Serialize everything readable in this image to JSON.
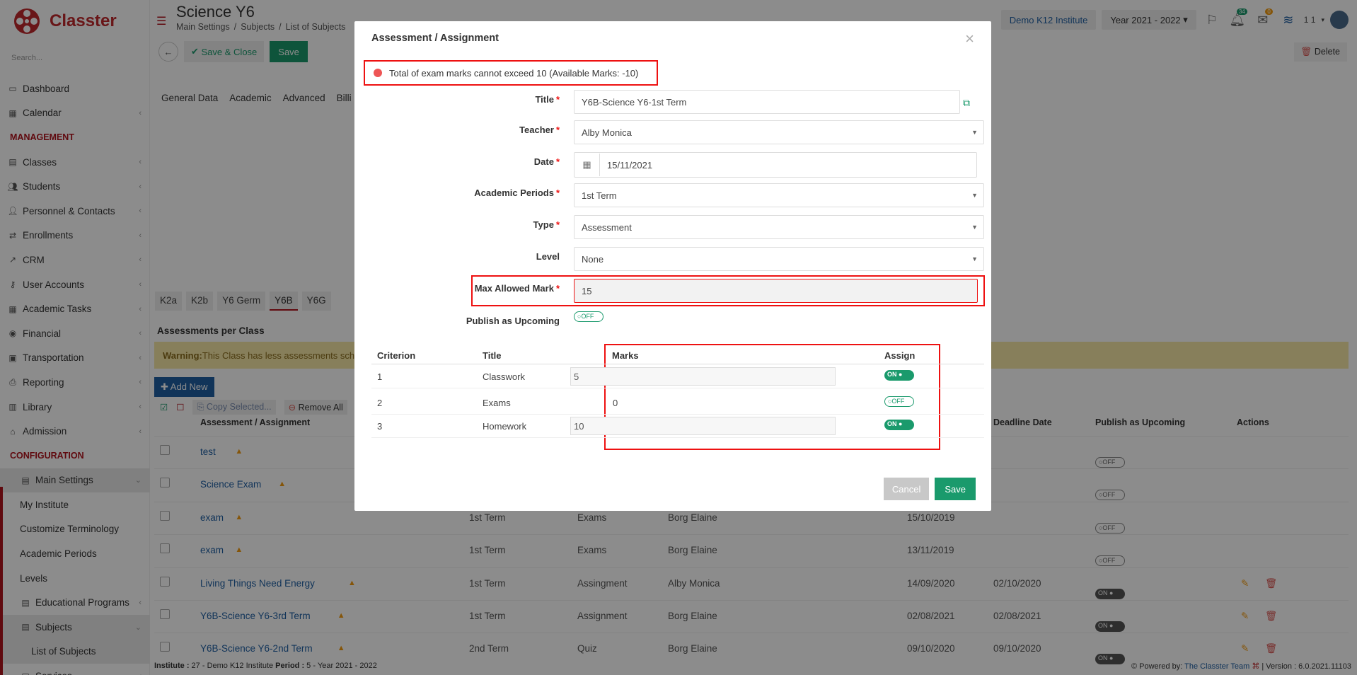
{
  "app": {
    "name": "Classter"
  },
  "sidebar": {
    "search_placeholder": "Search...",
    "items": [
      {
        "label": "Dashboard",
        "icon": "monitor-icon",
        "chev": ""
      },
      {
        "label": "Calendar",
        "icon": "calendar-icon",
        "chev": "‹"
      }
    ],
    "management_label": "MANAGEMENT",
    "mgmt_items": [
      {
        "label": "Classes",
        "icon": "classes-icon",
        "chev": "‹"
      },
      {
        "label": "Students",
        "icon": "students-icon",
        "chev": "‹"
      },
      {
        "label": "Personnel & Contacts",
        "icon": "personnel-icon",
        "chev": "‹"
      },
      {
        "label": "Enrollments",
        "icon": "enrollments-icon",
        "chev": "‹"
      },
      {
        "label": "CRM",
        "icon": "crm-icon",
        "chev": "‹"
      },
      {
        "label": "User Accounts",
        "icon": "key-icon",
        "chev": "‹"
      },
      {
        "label": "Academic Tasks",
        "icon": "tasks-icon",
        "chev": "‹"
      },
      {
        "label": "Financial",
        "icon": "financial-icon",
        "chev": "‹"
      },
      {
        "label": "Transportation",
        "icon": "bus-icon",
        "chev": "‹"
      },
      {
        "label": "Reporting",
        "icon": "printer-icon",
        "chev": "‹"
      },
      {
        "label": "Library",
        "icon": "library-icon",
        "chev": "‹"
      },
      {
        "label": "Admission",
        "icon": "admission-icon",
        "chev": "‹"
      }
    ],
    "configuration_label": "CONFIGURATION",
    "main_settings": "Main Settings",
    "settings_items": [
      "My Institute",
      "Customize Terminology",
      "Academic Periods",
      "Levels"
    ],
    "educational_programs": "Educational Programs",
    "subjects": "Subjects",
    "list_of_subjects": "List of Subjects",
    "services": "Services"
  },
  "header": {
    "title": "Science Y6",
    "breadcrumb": [
      "Main Settings",
      "/",
      "Subjects",
      "/",
      "List of Subjects"
    ],
    "institute": "Demo K12 Institute",
    "year": "Year 2021 - 2022",
    "notif_count": "34",
    "msg_count": "0",
    "user": "1 1"
  },
  "toolbar": {
    "save_close": "Save & Close",
    "save": "Save",
    "delete": "Delete"
  },
  "tabs": [
    "General Data",
    "Academic",
    "Advanced",
    "Billi"
  ],
  "class_tabs": [
    "K2a",
    "K2b",
    "Y6 Germ",
    "Y6B",
    "Y6G"
  ],
  "assessments": {
    "title": "Assessments per Class",
    "warning_bold": "Warning:",
    "warning_text": " This Class has less assessments sche",
    "add_new": "Add New",
    "copy_selected": "Copy Selected...",
    "remove_all": "Remove All",
    "columns": {
      "name": "Assessment / Assignment",
      "deadline": "Deadline Date",
      "publish": "Publish as Upcoming",
      "actions": "Actions"
    },
    "rows": [
      {
        "name": "test",
        "period": "",
        "type": "",
        "teacher": "",
        "date": "",
        "deadline": "",
        "publish": "OFF",
        "actions": false,
        "warn": true
      },
      {
        "name": "Science Exam",
        "period": "",
        "type": "",
        "teacher": "",
        "date": "",
        "deadline": "",
        "publish": "OFF",
        "actions": false,
        "warn": true
      },
      {
        "name": "exam",
        "period": "1st Term",
        "type": "Exams",
        "teacher": "Borg Elaine",
        "date": "15/10/2019",
        "deadline": "",
        "publish": "OFF",
        "actions": false,
        "warn": true
      },
      {
        "name": "exam",
        "period": "1st Term",
        "type": "Exams",
        "teacher": "Borg Elaine",
        "date": "13/11/2019",
        "deadline": "",
        "publish": "OFF",
        "actions": false,
        "warn": true
      },
      {
        "name": "Living Things Need Energy",
        "period": "1st Term",
        "type": "Assingment",
        "teacher": "Alby Monica",
        "date": "14/09/2020",
        "deadline": "02/10/2020",
        "publish": "ON",
        "actions": true,
        "warn": true
      },
      {
        "name": "Y6B-Science Y6-3rd Term",
        "period": "1st Term",
        "type": "Assignment",
        "teacher": "Borg Elaine",
        "date": "02/08/2021",
        "deadline": "02/08/2021",
        "publish": "ON",
        "actions": true,
        "warn": true
      },
      {
        "name": "Y6B-Science Y6-2nd Term",
        "period": "2nd Term",
        "type": "Quiz",
        "teacher": "Borg Elaine",
        "date": "09/10/2020",
        "deadline": "09/10/2020",
        "publish": "ON",
        "actions": true,
        "warn": true
      }
    ]
  },
  "footer": {
    "left_inst_label": "Institute :",
    "left_inst": " 27 - Demo K12 Institute ",
    "left_period_label": "Period :",
    "left_period": " 5 - Year 2021 - 2022",
    "powered": "Powered by: ",
    "team": "The Classter Team",
    "version": " | Version : 6.0.2021.11103"
  },
  "modal": {
    "title": "Assessment / Assignment",
    "error": "Total of exam marks cannot exceed 10 (Available Marks: -10)",
    "fields": {
      "title_label": "Title",
      "title_value": "Y6B-Science Y6-1st Term",
      "teacher_label": "Teacher",
      "teacher_value": "Alby Monica",
      "date_label": "Date",
      "date_value": "15/11/2021",
      "periods_label": "Academic Periods",
      "periods_value": "1st Term",
      "type_label": "Type",
      "type_value": "Assessment",
      "level_label": "Level",
      "level_value": "None",
      "max_label": "Max Allowed Mark",
      "max_value": "15",
      "publish_label": "Publish as Upcoming",
      "publish_value": "OFF"
    },
    "criteria": {
      "headers": {
        "criterion": "Criterion",
        "title": "Title",
        "marks": "Marks",
        "assign": "Assign"
      },
      "rows": [
        {
          "n": "1",
          "title": "Classwork",
          "marks": "5",
          "editable": true,
          "assign": "ON"
        },
        {
          "n": "2",
          "title": "Exams",
          "marks": "0",
          "editable": false,
          "assign": "OFF"
        },
        {
          "n": "3",
          "title": "Homework",
          "marks": "10",
          "editable": true,
          "assign": "ON"
        }
      ]
    },
    "cancel": "Cancel",
    "save": "Save"
  }
}
